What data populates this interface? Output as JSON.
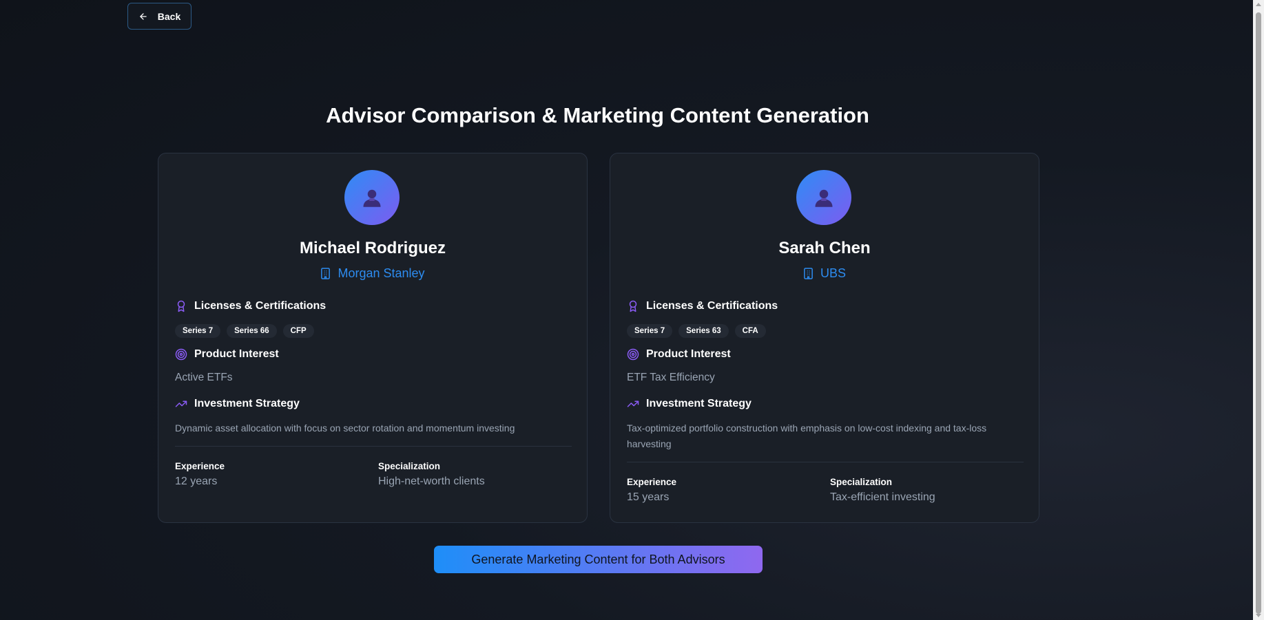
{
  "nav": {
    "back_label": "Back"
  },
  "page": {
    "title": "Advisor Comparison & Marketing Content Generation"
  },
  "labels": {
    "licenses": "Licenses & Certifications",
    "product_interest": "Product Interest",
    "investment_strategy": "Investment Strategy",
    "experience": "Experience",
    "specialization": "Specialization"
  },
  "advisors": [
    {
      "name": "Michael Rodriguez",
      "firm": "Morgan Stanley",
      "licenses": [
        "Series 7",
        "Series 66",
        "CFP"
      ],
      "product_interest": "Active ETFs",
      "investment_strategy": "Dynamic asset allocation with focus on sector rotation and momentum investing",
      "experience": "12 years",
      "specialization": "High-net-worth clients"
    },
    {
      "name": "Sarah Chen",
      "firm": "UBS",
      "licenses": [
        "Series 7",
        "Series 63",
        "CFA"
      ],
      "product_interest": "ETF Tax Efficiency",
      "investment_strategy": "Tax-optimized portfolio construction with emphasis on low-cost indexing and tax-loss harvesting",
      "experience": "15 years",
      "specialization": "Tax-efficient investing"
    }
  ],
  "actions": {
    "generate_label": "Generate Marketing Content for Both Advisors"
  },
  "colors": {
    "accent_blue": "#2d8cf0",
    "accent_purple": "#8b5cf6",
    "background": "#141922",
    "card": "#1a1f27"
  },
  "icons": {
    "back": "arrow-left-icon",
    "avatar": "user-icon",
    "firm": "building-icon",
    "licenses": "award-icon",
    "product": "target-icon",
    "strategy": "trending-up-icon"
  }
}
